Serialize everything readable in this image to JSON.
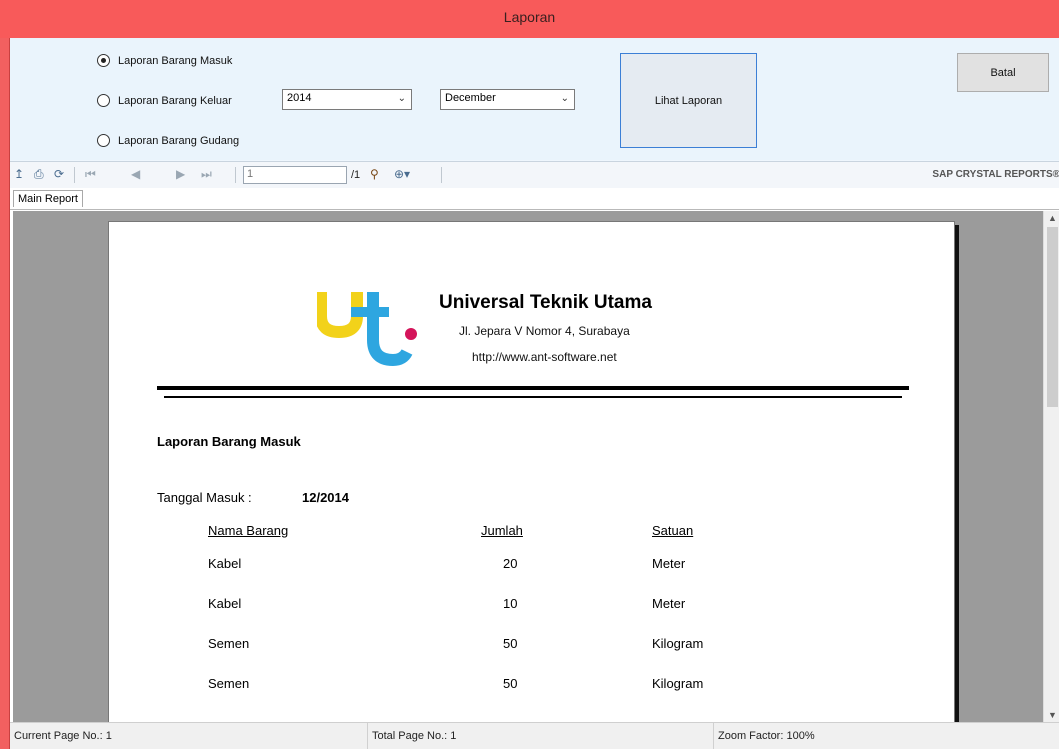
{
  "window": {
    "title": "Laporan"
  },
  "filters": {
    "radios": [
      {
        "label": "Laporan Barang Masuk",
        "checked": true
      },
      {
        "label": "Laporan Barang Keluar",
        "checked": false
      },
      {
        "label": "Laporan Barang Gudang",
        "checked": false
      }
    ],
    "year_select": {
      "value": "2014"
    },
    "month_select": {
      "value": "December"
    },
    "view_button": "Lihat Laporan",
    "cancel_button": "Batal"
  },
  "toolbar": {
    "page_input": "1",
    "page_total": "/1",
    "brand": "SAP CRYSTAL REPORTS®",
    "icons": [
      "export-icon",
      "print-icon",
      "refresh-icon",
      "first-page-icon",
      "prev-page-icon",
      "next-page-icon",
      "last-page-icon",
      "find-icon",
      "zoom-icon"
    ]
  },
  "tabs": [
    "Main Report"
  ],
  "report": {
    "company": "Universal Teknik Utama",
    "address": "Jl. Jepara V Nomor 4, Surabaya",
    "website": "http://www.ant-software.net",
    "title": "Laporan Barang Masuk",
    "date_label": "Tanggal Masuk :",
    "date_value": "12/2014",
    "columns": [
      "Nama Barang",
      "Jumlah",
      "Satuan"
    ],
    "rows": [
      {
        "name": "Kabel",
        "qty": "20",
        "unit": "Meter"
      },
      {
        "name": "Kabel",
        "qty": "10",
        "unit": "Meter"
      },
      {
        "name": "Semen",
        "qty": "50",
        "unit": "Kilogram"
      },
      {
        "name": "Semen",
        "qty": "50",
        "unit": "Kilogram"
      }
    ]
  },
  "status": {
    "current": "Current Page No.: 1",
    "total": "Total Page No.: 1",
    "zoom": "Zoom Factor: 100%"
  },
  "colors": {
    "titlebar": "#f85a5a",
    "panel": "#eaf4fc",
    "logo_yellow": "#f2d21a",
    "logo_blue": "#2ea6e0",
    "logo_pink": "#d4145a"
  }
}
